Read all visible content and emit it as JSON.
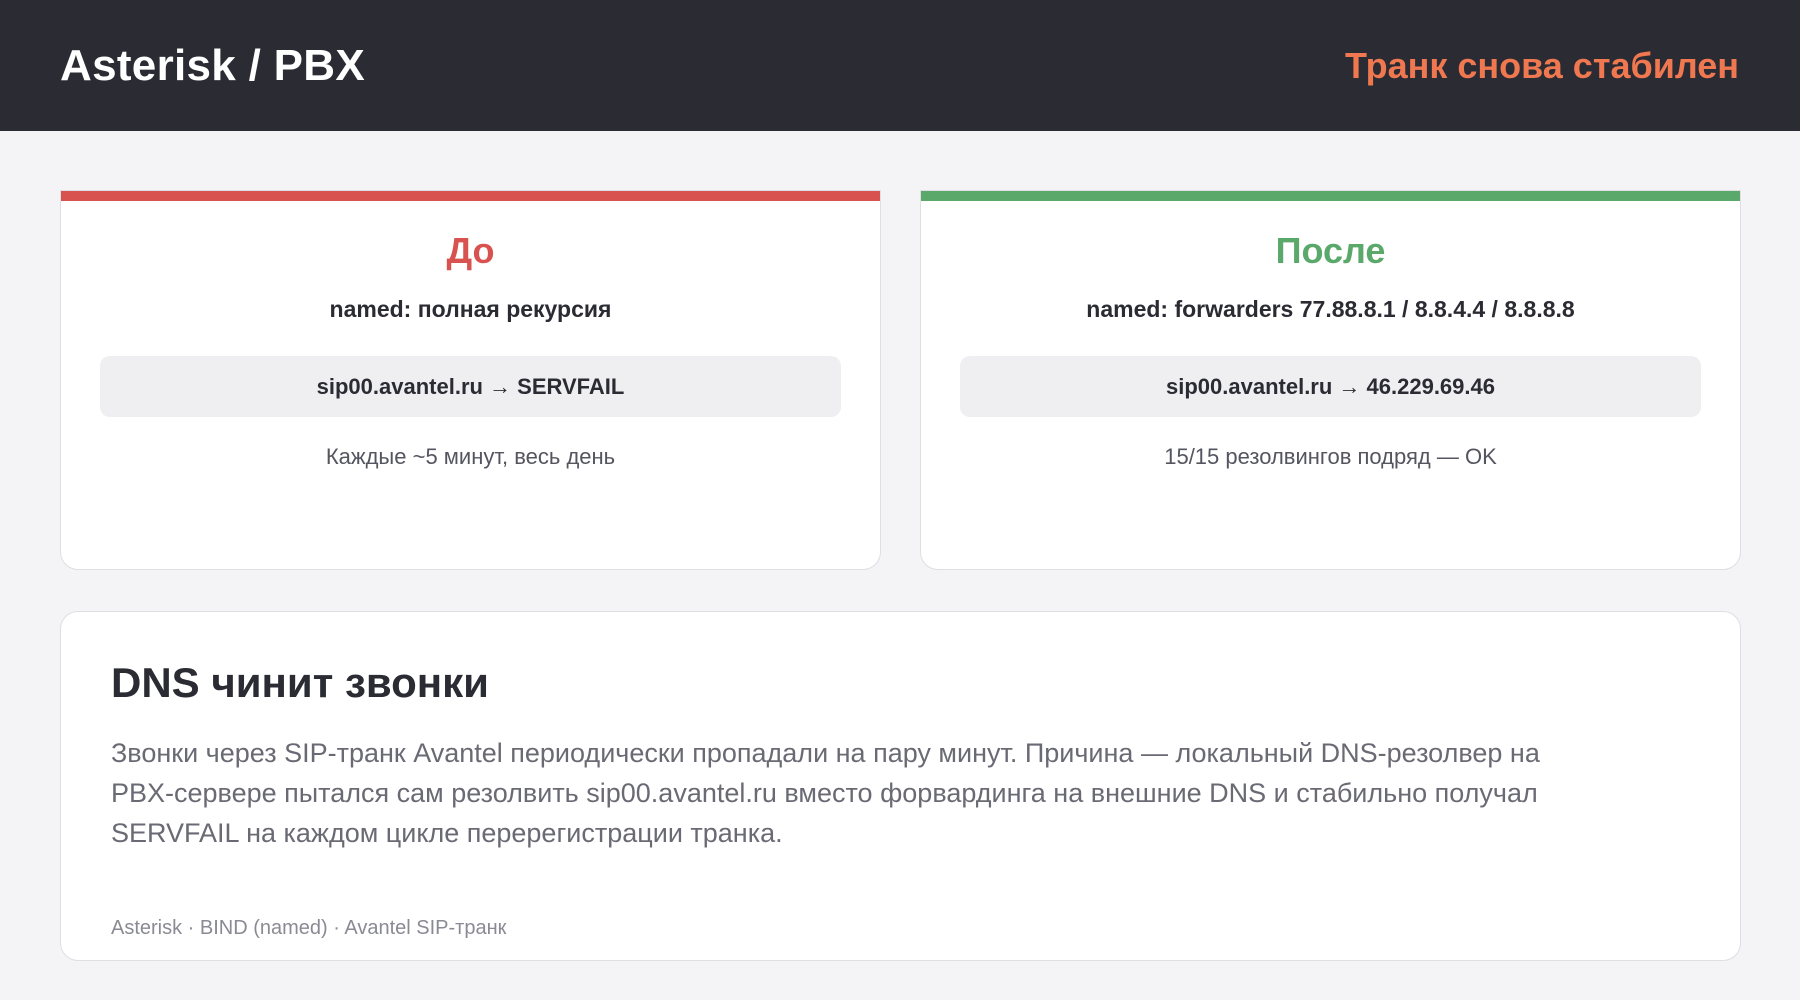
{
  "header": {
    "title": "Asterisk / PBX",
    "status": "Транк снова стабилен"
  },
  "colors": {
    "header_bg": "#2b2b34",
    "status_accent": "#f07850",
    "before_accent": "#d8534f",
    "after_accent": "#5ba86b"
  },
  "before": {
    "heading": "До",
    "config": "named: полная рекурсия",
    "result": "sip00.avantel.ru → SERVFAIL",
    "note": "Каждые ~5 минут, весь день"
  },
  "after": {
    "heading": "После",
    "config": "named: forwarders 77.88.8.1 / 8.8.4.4 / 8.8.8.8",
    "result": "sip00.avantel.ru → 46.229.69.46",
    "note": "15/15 резолвингов подряд — OK"
  },
  "summary": {
    "title": "DNS чинит звонки",
    "body": "Звонки через SIP-транк Avantel периодически пропадали на пару минут. Причина — локальный DNS-резолвер на PBX-сервере пытался сам резолвить sip00.avantel.ru вместо форвардинга на внешние DNS и стабильно получал SERVFAIL на каждом цикле перерегистрации транка.",
    "tags": "Asterisk · BIND (named) · Avantel SIP-транк"
  }
}
